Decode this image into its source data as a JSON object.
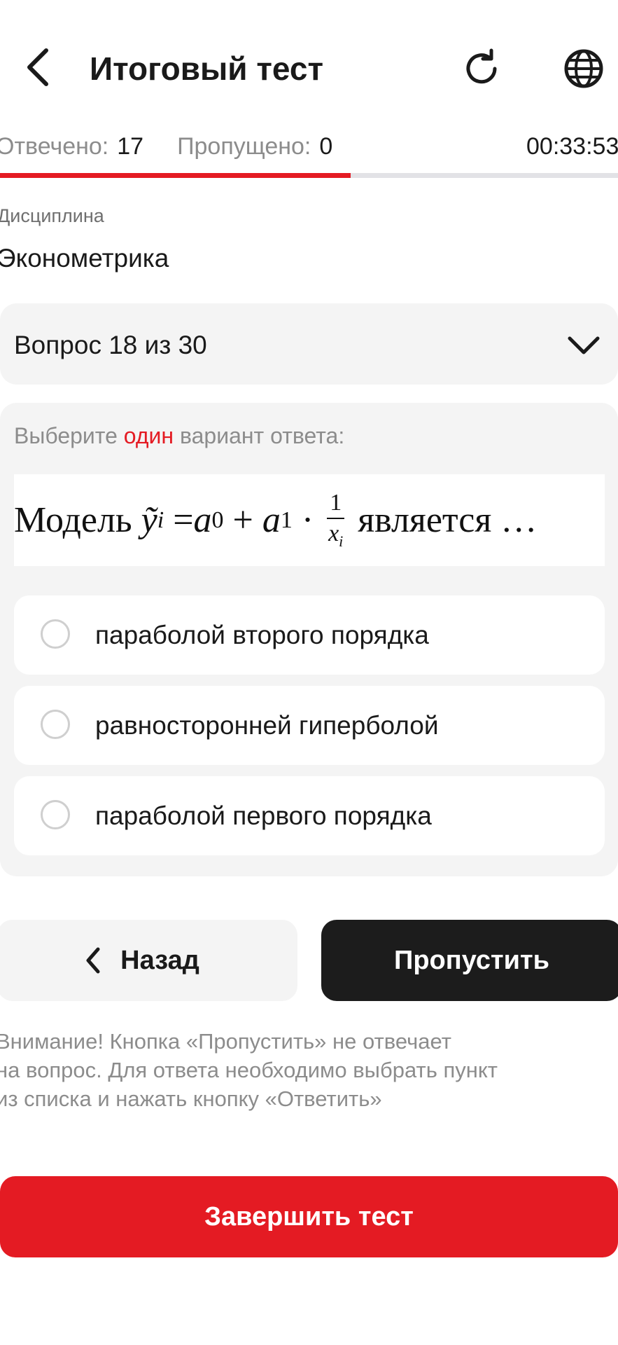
{
  "header": {
    "title": "Итоговый тест",
    "back_icon": "chevron-left-icon",
    "refresh_icon": "refresh-icon",
    "language_icon": "globe-icon"
  },
  "stats": {
    "answered_label": "Отвечено:",
    "answered_value": "17",
    "skipped_label": "Пропущено:",
    "skipped_value": "0",
    "timer": "00:33:53",
    "progress_fraction": 0.567
  },
  "discipline": {
    "label": "Дисциплина",
    "value": "Эконометрика"
  },
  "question_selector": {
    "text": "Вопрос 18 из 30",
    "icon": "chevron-down-icon"
  },
  "question": {
    "instruction_before": "Выберите",
    "instruction_accent": "один",
    "instruction_after": "вариант ответа:",
    "formula": {
      "prefix": "Модель",
      "lhs": "ỹ",
      "lhs_sub": "i",
      "eq": "= ",
      "a0": "a",
      "a0_sub": "0",
      "plus": " + ",
      "a1": "a",
      "a1_sub": "1",
      "dot": " · ",
      "frac_num": "1",
      "frac_den": "x",
      "frac_den_sub": "i",
      "suffix": "является …"
    },
    "options": [
      {
        "label": "параболой второго порядка",
        "selected": false
      },
      {
        "label": "равносторонней гиперболой",
        "selected": false
      },
      {
        "label": "параболой первого порядка",
        "selected": false
      }
    ]
  },
  "buttons": {
    "back_label": "Назад",
    "skip_label": "Пропустить",
    "finish_label": "Завершить тест"
  },
  "colors": {
    "accent": "#e41b23",
    "dark_button": "#1c1c1c",
    "surface": "#f4f4f4"
  },
  "warning": {
    "line1": "Внимание! Кнопка «Пропустить» не отвечает",
    "line2": "на вопрос. Для ответа необходимо выбрать пункт",
    "line3": "из списка и нажать кнопку «Ответить»"
  }
}
